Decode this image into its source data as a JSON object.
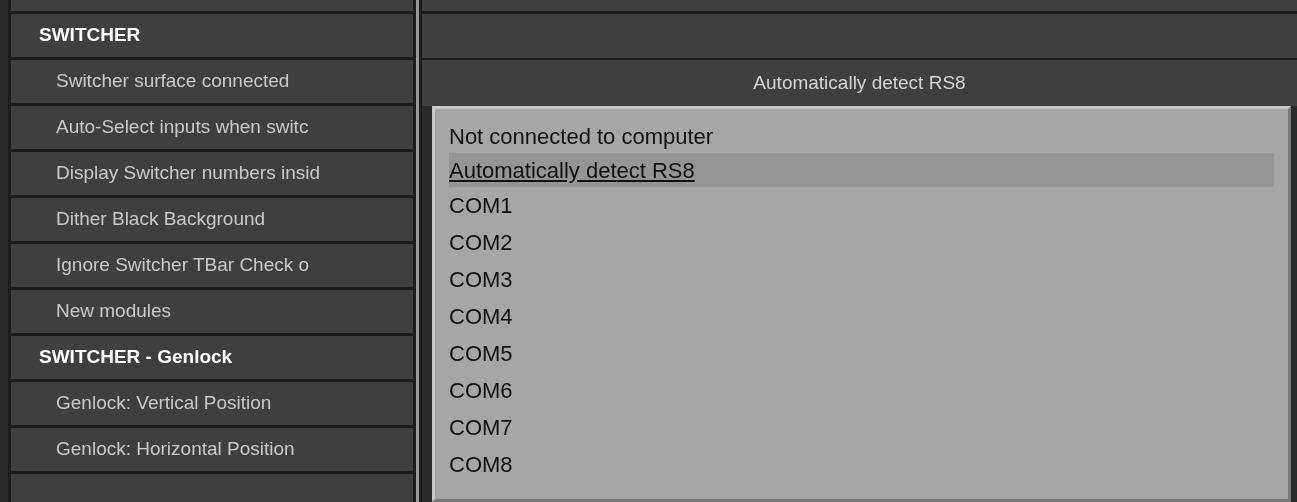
{
  "settings": {
    "rows": [
      {
        "kind": "header",
        "label": "SWITCHER"
      },
      {
        "kind": "item",
        "label": "Switcher surface connected"
      },
      {
        "kind": "item",
        "label": "Auto-Select inputs when switc"
      },
      {
        "kind": "item",
        "label": "Display Switcher numbers insid"
      },
      {
        "kind": "item",
        "label": "Dither Black Background"
      },
      {
        "kind": "item",
        "label": "Ignore Switcher TBar Check o"
      },
      {
        "kind": "item",
        "label": "New modules"
      },
      {
        "kind": "header",
        "label": "SWITCHER - Genlock"
      },
      {
        "kind": "item",
        "label": "Genlock: Vertical Position"
      },
      {
        "kind": "item",
        "label": "Genlock: Horizontal Position"
      }
    ]
  },
  "value_field": {
    "value": "Automatically detect RS8"
  },
  "dropdown": {
    "options": [
      {
        "label": "Not connected to computer",
        "selected": false
      },
      {
        "label": "Automatically detect RS8",
        "selected": true
      },
      {
        "label": "COM1",
        "selected": false
      },
      {
        "label": "COM2",
        "selected": false
      },
      {
        "label": "COM3",
        "selected": false
      },
      {
        "label": "COM4",
        "selected": false
      },
      {
        "label": "COM5",
        "selected": false
      },
      {
        "label": "COM6",
        "selected": false
      },
      {
        "label": "COM7",
        "selected": false
      },
      {
        "label": "COM8",
        "selected": false
      }
    ]
  }
}
